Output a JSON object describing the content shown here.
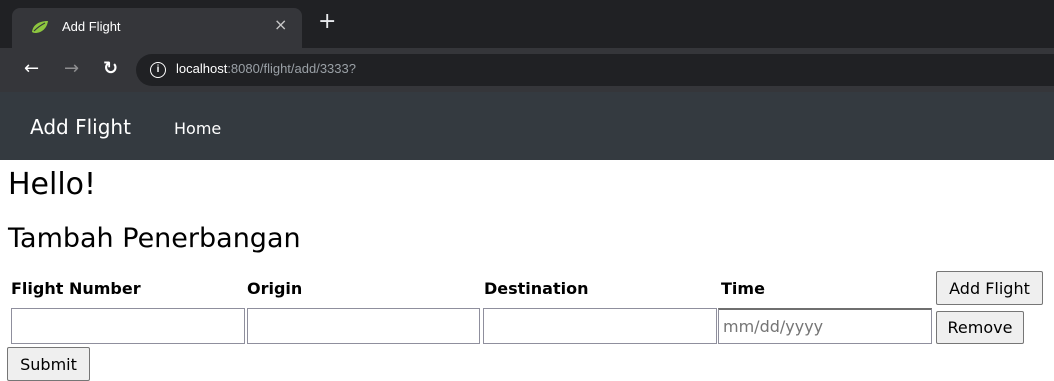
{
  "browser": {
    "tab_title": "Add Flight",
    "tab_close": "×",
    "new_tab": "+",
    "url_host": "localhost",
    "url_path": ":8080/flight/add/3333?"
  },
  "navbar": {
    "brand": "Add Flight",
    "home_link": "Home",
    "background_color": "#343a40"
  },
  "page": {
    "greeting": "Hello!",
    "heading": "Tambah Penerbangan"
  },
  "form": {
    "columns": [
      "Flight Number",
      "Origin",
      "Destination",
      "Time"
    ],
    "fields": {
      "flight_number": "",
      "origin": "",
      "destination": "",
      "time_placeholder": "mm/dd/yyyy"
    },
    "add_flight_label": "Add Flight",
    "remove_label": "Remove",
    "submit_label": "Submit"
  }
}
